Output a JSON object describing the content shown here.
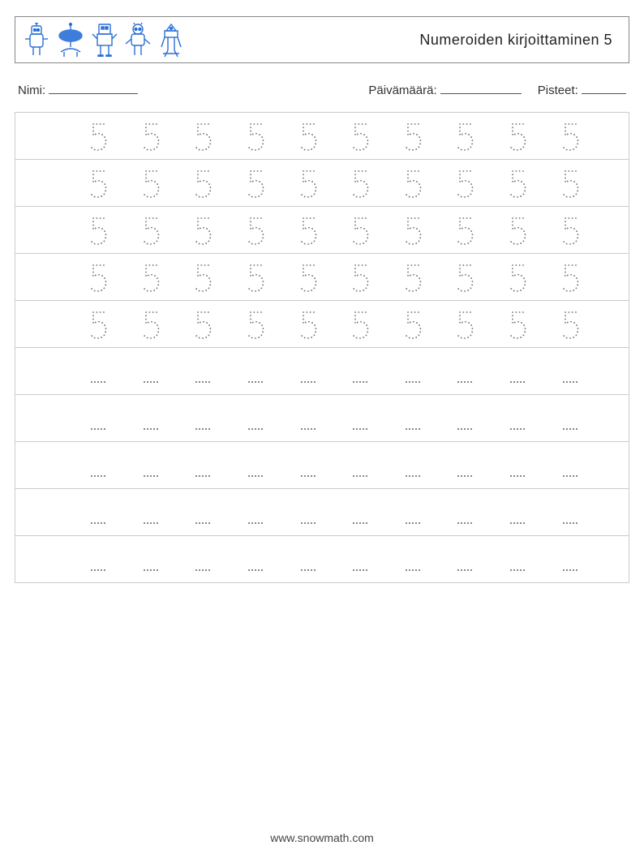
{
  "header": {
    "title": "Numeroiden kirjoittaminen 5"
  },
  "meta": {
    "name_label": "Nimi:",
    "date_label": "Päivämäärä:",
    "score_label": "Pisteet:"
  },
  "worksheet": {
    "digit": "5",
    "columns_per_row": 10,
    "trace_rows": 5,
    "blank_rows": 5
  },
  "footer": {
    "url": "www.snowmath.com"
  },
  "icons": {
    "robot_colors": [
      "#2a6fd6",
      "#2a6fd6",
      "#2a6fd6",
      "#2a6fd6",
      "#2a6fd6"
    ]
  }
}
